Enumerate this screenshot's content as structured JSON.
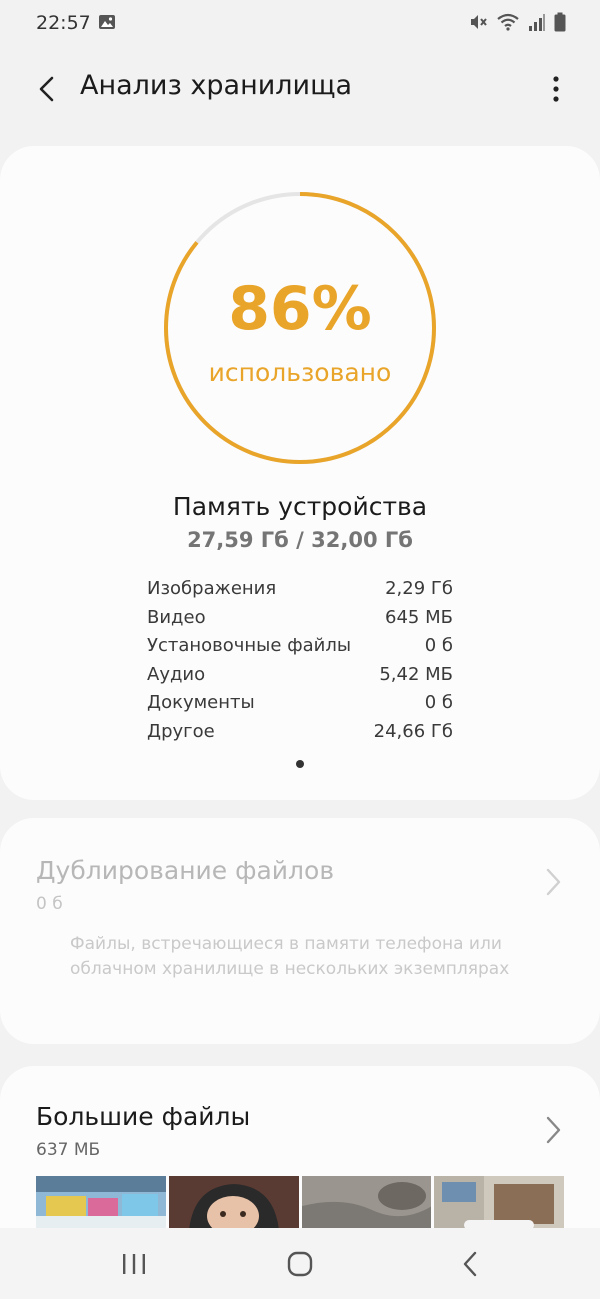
{
  "status_bar": {
    "time": "22:57",
    "icons": [
      "image-notification-icon",
      "mute-icon",
      "wifi-icon",
      "signal-icon",
      "battery-icon"
    ]
  },
  "app_bar": {
    "title": "Анализ хранилища",
    "back_icon": "back-arrow-icon",
    "more_icon": "more-vert-icon"
  },
  "storage": {
    "percent_text": "86%",
    "percent_value": 86,
    "percent_label": "использовано",
    "title": "Память устройства",
    "usage": "27,59 Гб / 32,00 Гб",
    "accent_color": "#e9a42a",
    "breakdown": [
      {
        "label": "Изображения",
        "value": "2,29 Гб"
      },
      {
        "label": "Видео",
        "value": "645 МБ"
      },
      {
        "label": "Установочные файлы",
        "value": "0 б"
      },
      {
        "label": "Аудио",
        "value": "5,42 МБ"
      },
      {
        "label": "Документы",
        "value": "0 б"
      },
      {
        "label": "Другое",
        "value": "24,66 Гб"
      }
    ]
  },
  "duplicates": {
    "title": "Дублирование файлов",
    "size": "0 б",
    "description": "Файлы, встречающиеся в памяти телефона или облачном хранилище в нескольких экземплярах"
  },
  "large_files": {
    "title": "Большие файлы",
    "size": "637 МБ"
  },
  "nav_bar": {
    "icons": [
      "recent-apps-icon",
      "home-icon",
      "back-icon"
    ]
  }
}
